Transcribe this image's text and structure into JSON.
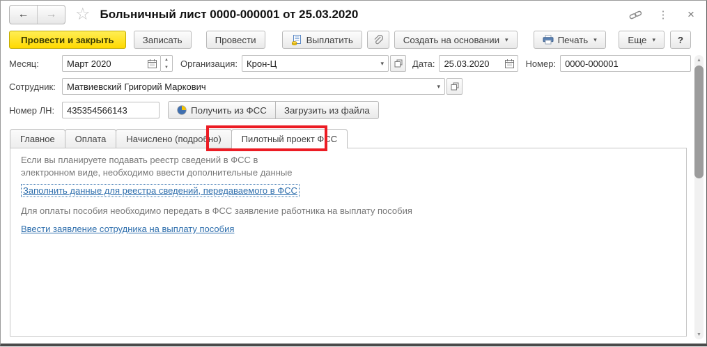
{
  "window": {
    "title": "Больничный лист 0000-000001 от 25.03.2020"
  },
  "icons": {
    "back": "←",
    "forward": "→",
    "star": "☆",
    "more_vertical": "⋮",
    "close": "×",
    "caret": "▾",
    "combo_arrow": "▾",
    "spinner_up": "▲",
    "spinner_down": "▼",
    "scroll_up": "▲",
    "scroll_down": "▼"
  },
  "toolbar": {
    "post_and_close": "Провести и закрыть",
    "save": "Записать",
    "post": "Провести",
    "pay": "Выплатить",
    "create_based_on": "Создать на основании",
    "print": "Печать",
    "more": "Еще",
    "help": "?"
  },
  "form": {
    "month": {
      "label": "Месяц:",
      "value": "Март 2020"
    },
    "organization": {
      "label": "Организация:",
      "value": "Крон-Ц"
    },
    "date": {
      "label": "Дата:",
      "value": "25.03.2020"
    },
    "number": {
      "label": "Номер:",
      "value": "0000-000001"
    },
    "employee": {
      "label": "Сотрудник:",
      "value": "Матвиевский Григорий Маркович"
    },
    "ln_number": {
      "label": "Номер ЛН:",
      "value": "435354566143"
    },
    "get_from_fss": "Получить из ФСС",
    "load_from_file": "Загрузить из файла"
  },
  "tabs": [
    {
      "label": "Главное"
    },
    {
      "label": "Оплата"
    },
    {
      "label": "Начислено (подробно)"
    },
    {
      "label": "Пилотный проект ФСС"
    }
  ],
  "content": {
    "info1_line1": "Если вы планируете подавать реестр сведений в ФСС в",
    "info1_line2": "электронном виде, необходимо ввести дополнительные данные",
    "link_fill_registry": "Заполнить данные для реестра сведений, передаваемого в ФСС",
    "info2": "Для оплаты пособия необходимо передать в ФСС заявление работника на выплату пособия",
    "link_enter_application": "Ввести заявление сотрудника на выплату пособия"
  },
  "colors": {
    "accent_yellow": "#ffdf00",
    "link_blue": "#2f6fad",
    "highlight_red": "#ec1c24"
  }
}
